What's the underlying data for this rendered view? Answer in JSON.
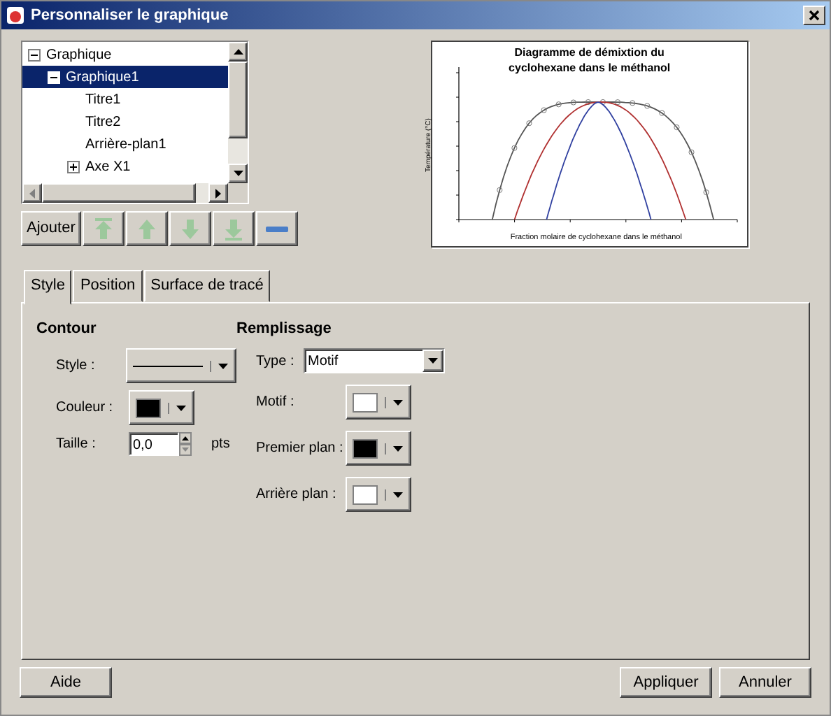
{
  "window": {
    "title": "Personnaliser le graphique"
  },
  "tree": [
    {
      "label": "Graphique",
      "expanded": true,
      "selected": false,
      "children": [
        {
          "label": "Graphique1",
          "expanded": true,
          "selected": true,
          "children": [
            {
              "label": "Titre1",
              "selected": false
            },
            {
              "label": "Titre2",
              "selected": false
            },
            {
              "label": "Arrière-plan1",
              "selected": false
            },
            {
              "label": "Axe X1",
              "expanded": false,
              "selected": false
            }
          ]
        }
      ]
    }
  ],
  "tree_buttons": [
    {
      "kind": "text",
      "label": "Ajouter",
      "disabled": false
    },
    {
      "kind": "move-top",
      "disabled": true
    },
    {
      "kind": "move-up",
      "disabled": true
    },
    {
      "kind": "move-down",
      "disabled": true
    },
    {
      "kind": "move-bottom",
      "disabled": true
    },
    {
      "kind": "remove",
      "disabled": false
    }
  ],
  "preview": {
    "title_lines": [
      "Diagramme de démixtion du",
      "cyclohexane dans le méthanol"
    ],
    "xlabel": "Fraction molaire de cyclohexane dans le méthanol",
    "ylabel": "Température (°C)"
  },
  "tabs": [
    {
      "label": "Style",
      "selected": true
    },
    {
      "label": "Position",
      "selected": false
    },
    {
      "label": "Surface de tracé",
      "selected": false
    }
  ],
  "contour": {
    "heading": "Contour",
    "fields": [
      {
        "kind": "line",
        "label": "Style :"
      },
      {
        "kind": "color",
        "label": "Couleur :",
        "color": "#000000"
      },
      {
        "kind": "spin",
        "label": "Taille :",
        "value": "0,0",
        "unit": "pts"
      }
    ]
  },
  "fill": {
    "heading": "Remplissage",
    "fields": [
      {
        "kind": "select",
        "label": "Type :",
        "value": "Motif"
      },
      {
        "kind": "color",
        "label": "Motif :",
        "color": "#ffffff"
      },
      {
        "kind": "color",
        "label": "Premier plan :",
        "color": "#000000"
      },
      {
        "kind": "color",
        "label": "Arrière plan :",
        "color": "#ffffff"
      }
    ]
  },
  "buttons_left": [
    "Aide"
  ],
  "buttons_right": [
    "Appliquer",
    "Annuler"
  ]
}
